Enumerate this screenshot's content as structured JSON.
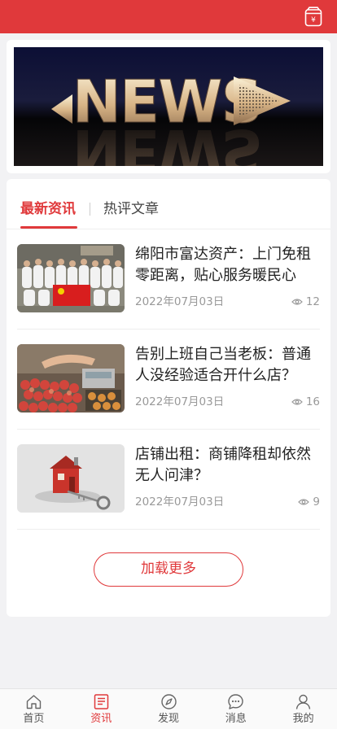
{
  "header": {
    "wallet_icon": "wallet-yen-icon",
    "accent_color": "#e0393b"
  },
  "banner": {
    "text": "NEWS"
  },
  "tabs": [
    {
      "label": "最新资讯",
      "active": true
    },
    {
      "label": "热评文章",
      "active": false
    }
  ],
  "articles": [
    {
      "title": "绵阳市富达资产：上门免租零距离，贴心服务暖民心",
      "date": "2022年07月03日",
      "views": "12"
    },
    {
      "title": "告别上班自己当老板：普通人没经验适合开什么店？",
      "date": "2022年07月03日",
      "views": "16"
    },
    {
      "title": "店铺出租：商铺降租却依然无人问津？",
      "date": "2022年07月03日",
      "views": "9"
    }
  ],
  "load_more_label": "加载更多",
  "bottom_nav": [
    {
      "label": "首页",
      "icon": "home-icon",
      "active": false
    },
    {
      "label": "资讯",
      "icon": "news-icon",
      "active": true
    },
    {
      "label": "发现",
      "icon": "compass-icon",
      "active": false
    },
    {
      "label": "消息",
      "icon": "message-icon",
      "active": false
    },
    {
      "label": "我的",
      "icon": "user-icon",
      "active": false
    }
  ]
}
